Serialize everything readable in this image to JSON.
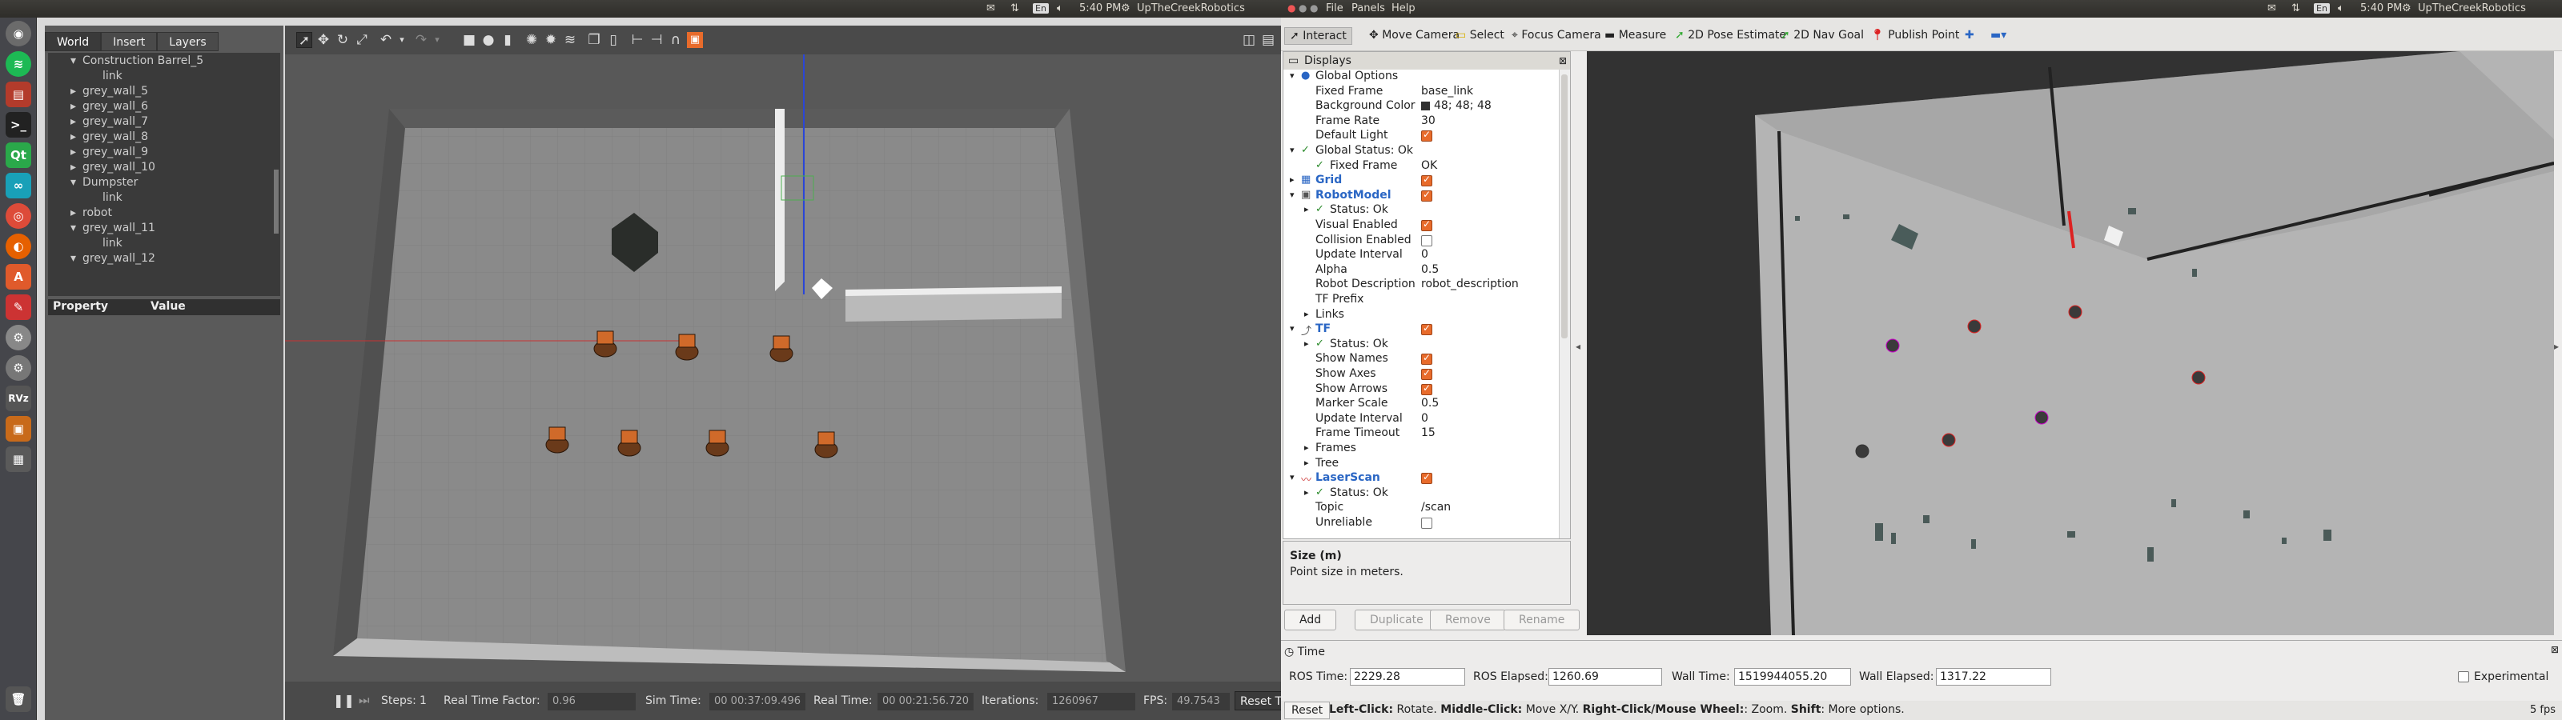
{
  "left_topbar": {
    "time": "5:40 PM",
    "user": "UpTheCreekRobotics",
    "lang": "En"
  },
  "right_topbar": {
    "menus": [
      "File",
      "Panels",
      "Help"
    ],
    "time": "5:40 PM",
    "user": "UpTheCreekRobotics",
    "lang": "En"
  },
  "gazebo": {
    "tabs": [
      "World",
      "Insert",
      "Layers"
    ],
    "tree": [
      {
        "label": "Construction Barrel_5",
        "expand": "▾"
      },
      {
        "label": "link",
        "expand": ""
      },
      {
        "label": "grey_wall_5",
        "expand": "▸"
      },
      {
        "label": "grey_wall_6",
        "expand": "▸"
      },
      {
        "label": "grey_wall_7",
        "expand": "▸"
      },
      {
        "label": "grey_wall_8",
        "expand": "▸"
      },
      {
        "label": "grey_wall_9",
        "expand": "▸"
      },
      {
        "label": "grey_wall_10",
        "expand": "▸"
      },
      {
        "label": "Dumpster",
        "expand": "▾"
      },
      {
        "label": "link",
        "expand": ""
      },
      {
        "label": "robot",
        "expand": "▸"
      },
      {
        "label": "grey_wall_11",
        "expand": "▾"
      },
      {
        "label": "link",
        "expand": ""
      },
      {
        "label": "grey_wall_12",
        "expand": "▾"
      }
    ],
    "property_header": [
      "Property",
      "Value"
    ],
    "bottom": {
      "steps_label": "Steps:",
      "steps_value": "1",
      "rtf_label": "Real Time Factor:",
      "rtf_value": "0.96",
      "sim_label": "Sim Time:",
      "sim_value": "00 00:37:09.496",
      "real_label": "Real Time:",
      "real_value": "00 00:21:56.720",
      "iter_label": "Iterations:",
      "iter_value": "1260967",
      "fps_label": "FPS:",
      "fps_value": "49.7543",
      "reset_label": "Reset Time"
    }
  },
  "rviz": {
    "tools": [
      "Interact",
      "Move Camera",
      "Select",
      "Focus Camera",
      "Measure",
      "2D Pose Estimate",
      "2D Nav Goal",
      "Publish Point"
    ],
    "displays_title": "Displays",
    "rows": [
      {
        "indent": 0,
        "expand": "▾",
        "label": "Global Options",
        "value": "",
        "check": "",
        "style": "plain",
        "icon": "globe"
      },
      {
        "indent": 1,
        "expand": "",
        "label": "Fixed Frame",
        "value": "base_link",
        "check": "",
        "style": "plain",
        "icon": ""
      },
      {
        "indent": 1,
        "expand": "",
        "label": "Background Color",
        "value": "48; 48; 48",
        "check": "",
        "style": "plain",
        "icon": "swatch"
      },
      {
        "indent": 1,
        "expand": "",
        "label": "Frame Rate",
        "value": "30",
        "check": "",
        "style": "plain",
        "icon": ""
      },
      {
        "indent": 1,
        "expand": "",
        "label": "Default Light",
        "value": "",
        "check": "on",
        "style": "plain",
        "icon": ""
      },
      {
        "indent": 0,
        "expand": "▾",
        "label": "Global Status: Ok",
        "value": "",
        "check": "",
        "style": "plain",
        "icon": "ok"
      },
      {
        "indent": 1,
        "expand": "",
        "label": "Fixed Frame",
        "value": "OK",
        "check": "",
        "style": "plain",
        "icon": "ok"
      },
      {
        "indent": 0,
        "expand": "▸",
        "label": "Grid",
        "value": "",
        "check": "on",
        "style": "blue",
        "icon": "grid"
      },
      {
        "indent": 0,
        "expand": "▾",
        "label": "RobotModel",
        "value": "",
        "check": "on",
        "style": "blue",
        "icon": "robot"
      },
      {
        "indent": 1,
        "expand": "▸",
        "label": "Status: Ok",
        "value": "",
        "check": "",
        "style": "plain",
        "icon": "ok"
      },
      {
        "indent": 1,
        "expand": "",
        "label": "Visual Enabled",
        "value": "",
        "check": "on",
        "style": "plain",
        "icon": ""
      },
      {
        "indent": 1,
        "expand": "",
        "label": "Collision Enabled",
        "value": "",
        "check": "off",
        "style": "plain",
        "icon": ""
      },
      {
        "indent": 1,
        "expand": "",
        "label": "Update Interval",
        "value": "0",
        "check": "",
        "style": "plain",
        "icon": ""
      },
      {
        "indent": 1,
        "expand": "",
        "label": "Alpha",
        "value": "0.5",
        "check": "",
        "style": "plain",
        "icon": ""
      },
      {
        "indent": 1,
        "expand": "",
        "label": "Robot Description",
        "value": "robot_description",
        "check": "",
        "style": "plain",
        "icon": ""
      },
      {
        "indent": 1,
        "expand": "",
        "label": "TF Prefix",
        "value": "",
        "check": "",
        "style": "plain",
        "icon": ""
      },
      {
        "indent": 1,
        "expand": "▸",
        "label": "Links",
        "value": "",
        "check": "",
        "style": "plain",
        "icon": ""
      },
      {
        "indent": 0,
        "expand": "▾",
        "label": "TF",
        "value": "",
        "check": "on",
        "style": "blue",
        "icon": "tf"
      },
      {
        "indent": 1,
        "expand": "▸",
        "label": "Status: Ok",
        "value": "",
        "check": "",
        "style": "plain",
        "icon": "ok"
      },
      {
        "indent": 1,
        "expand": "",
        "label": "Show Names",
        "value": "",
        "check": "on",
        "style": "plain",
        "icon": ""
      },
      {
        "indent": 1,
        "expand": "",
        "label": "Show Axes",
        "value": "",
        "check": "on",
        "style": "plain",
        "icon": ""
      },
      {
        "indent": 1,
        "expand": "",
        "label": "Show Arrows",
        "value": "",
        "check": "on",
        "style": "plain",
        "icon": ""
      },
      {
        "indent": 1,
        "expand": "",
        "label": "Marker Scale",
        "value": "0.5",
        "check": "",
        "style": "plain",
        "icon": ""
      },
      {
        "indent": 1,
        "expand": "",
        "label": "Update Interval",
        "value": "0",
        "check": "",
        "style": "plain",
        "icon": ""
      },
      {
        "indent": 1,
        "expand": "",
        "label": "Frame Timeout",
        "value": "15",
        "check": "",
        "style": "plain",
        "icon": ""
      },
      {
        "indent": 1,
        "expand": "▸",
        "label": "Frames",
        "value": "",
        "check": "",
        "style": "plain",
        "icon": ""
      },
      {
        "indent": 1,
        "expand": "▸",
        "label": "Tree",
        "value": "",
        "check": "",
        "style": "plain",
        "icon": ""
      },
      {
        "indent": 0,
        "expand": "▾",
        "label": "LaserScan",
        "value": "",
        "check": "on",
        "style": "blue",
        "icon": "laser"
      },
      {
        "indent": 1,
        "expand": "▸",
        "label": "Status: Ok",
        "value": "",
        "check": "",
        "style": "plain",
        "icon": "ok"
      },
      {
        "indent": 1,
        "expand": "",
        "label": "Topic",
        "value": "/scan",
        "check": "",
        "style": "plain",
        "icon": ""
      },
      {
        "indent": 1,
        "expand": "",
        "label": "Unreliable",
        "value": "",
        "check": "off",
        "style": "plain",
        "icon": ""
      }
    ],
    "desc_title": "Size (m)",
    "desc_text": "Point size in meters.",
    "buttons": [
      "Add",
      "Duplicate",
      "Remove",
      "Rename"
    ],
    "time": {
      "title": "Time",
      "ros_time_label": "ROS Time:",
      "ros_time": "2229.28",
      "ros_elapsed_label": "ROS Elapsed:",
      "ros_elapsed": "1260.69",
      "wall_time_label": "Wall Time:",
      "wall_time": "1519944055.20",
      "wall_elapsed_label": "Wall Elapsed:",
      "wall_elapsed": "1317.22",
      "experimental": "Experimental"
    },
    "status": {
      "reset": "Reset",
      "text_bold1": "Left-Click:",
      "text1": " Rotate. ",
      "text_bold2": "Middle-Click:",
      "text2": " Move X/Y. ",
      "text_bold3": "Right-Click/Mouse Wheel:",
      "text3": ": Zoom. ",
      "text_bold4": "Shift",
      "text4": ": More options.",
      "fps": "5 fps"
    }
  },
  "colors": {
    "accent": "#e86b2b",
    "rviz_blue": "#2a66c4",
    "ok_green": "#2a8a2a"
  }
}
